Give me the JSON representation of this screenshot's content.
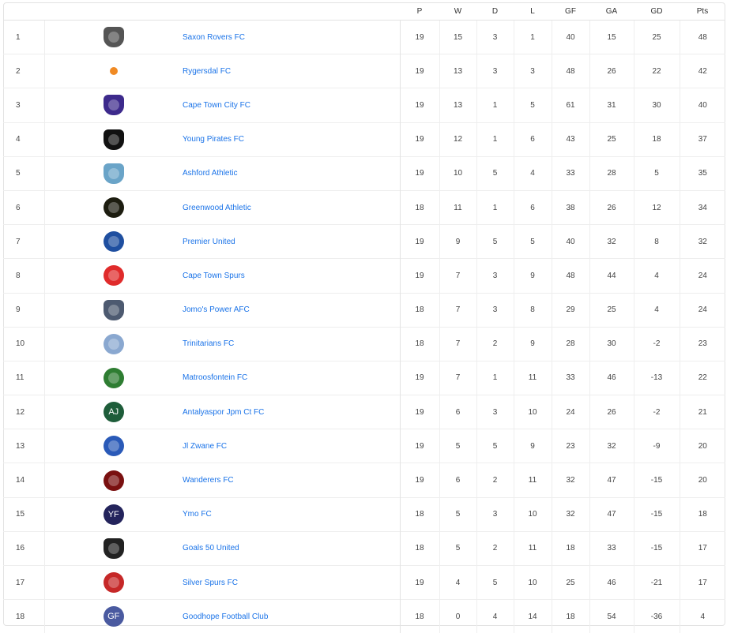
{
  "headers": [
    "P",
    "W",
    "D",
    "L",
    "GF",
    "GA",
    "GD",
    "Pts"
  ],
  "rows": [
    {
      "pos": "1",
      "team": "Saxon Rovers FC",
      "logo": "striped-shield-crest",
      "color": "#555555",
      "P": "19",
      "W": "15",
      "D": "3",
      "L": "1",
      "GF": "40",
      "GA": "15",
      "GD": "25",
      "Pts": "48"
    },
    {
      "pos": "2",
      "team": "Rygersdal FC",
      "logo": "small-orange-crest",
      "color": "#f08a24",
      "P": "19",
      "W": "13",
      "D": "3",
      "L": "3",
      "GF": "48",
      "GA": "26",
      "GD": "22",
      "Pts": "42"
    },
    {
      "pos": "3",
      "team": "Cape Town City FC",
      "logo": "purple-shield-crest",
      "color": "#3d2a8c",
      "P": "19",
      "W": "13",
      "D": "1",
      "L": "5",
      "GF": "61",
      "GA": "31",
      "GD": "30",
      "Pts": "40"
    },
    {
      "pos": "4",
      "team": "Young Pirates FC",
      "logo": "skull-crest",
      "color": "#111111",
      "P": "19",
      "W": "12",
      "D": "1",
      "L": "6",
      "GF": "43",
      "GA": "25",
      "GD": "18",
      "Pts": "37"
    },
    {
      "pos": "5",
      "team": "Ashford Athletic",
      "logo": "blue-square-crest",
      "color": "#6aa4c8",
      "P": "19",
      "W": "10",
      "D": "5",
      "L": "4",
      "GF": "33",
      "GA": "28",
      "GD": "5",
      "Pts": "35"
    },
    {
      "pos": "6",
      "team": "Greenwood Athletic",
      "logo": "black-gold-crest",
      "color": "#1d1d10",
      "P": "18",
      "W": "11",
      "D": "1",
      "L": "6",
      "GF": "38",
      "GA": "26",
      "GD": "12",
      "Pts": "34"
    },
    {
      "pos": "7",
      "team": "Premier United",
      "logo": "blue-ball-crest",
      "color": "#1f4fa0",
      "P": "19",
      "W": "9",
      "D": "5",
      "L": "5",
      "GF": "40",
      "GA": "32",
      "GD": "8",
      "Pts": "32"
    },
    {
      "pos": "8",
      "team": "Cape Town Spurs",
      "logo": "red-spur-crest",
      "color": "#e02b2b",
      "P": "19",
      "W": "7",
      "D": "3",
      "L": "9",
      "GF": "48",
      "GA": "44",
      "GD": "4",
      "Pts": "24"
    },
    {
      "pos": "9",
      "team": "Jomo's Power AFC",
      "logo": "grey-shield-crest",
      "color": "#4d5a70",
      "P": "18",
      "W": "7",
      "D": "3",
      "L": "8",
      "GF": "29",
      "GA": "25",
      "GD": "4",
      "Pts": "24"
    },
    {
      "pos": "10",
      "team": "Trinitarians FC",
      "logo": "light-blue-crest",
      "color": "#8aa8d0",
      "P": "18",
      "W": "7",
      "D": "2",
      "L": "9",
      "GF": "28",
      "GA": "30",
      "GD": "-2",
      "Pts": "23"
    },
    {
      "pos": "11",
      "team": "Matroosfontein FC",
      "logo": "green-red-crest",
      "color": "#2e7d32",
      "P": "19",
      "W": "7",
      "D": "1",
      "L": "11",
      "GF": "33",
      "GA": "46",
      "GD": "-13",
      "Pts": "22"
    },
    {
      "pos": "12",
      "team": "Antalyaspor Jpm Ct FC",
      "logo": "initials-crest",
      "initials": "AJ",
      "color": "#1e5d3a",
      "P": "19",
      "W": "6",
      "D": "3",
      "L": "10",
      "GF": "24",
      "GA": "26",
      "GD": "-2",
      "Pts": "21"
    },
    {
      "pos": "13",
      "team": "Jl Zwane FC",
      "logo": "blue-white-crest",
      "color": "#2a5ab8",
      "P": "19",
      "W": "5",
      "D": "5",
      "L": "9",
      "GF": "23",
      "GA": "32",
      "GD": "-9",
      "Pts": "20"
    },
    {
      "pos": "14",
      "team": "Wanderers FC",
      "logo": "dark-red-crest",
      "color": "#7a1010",
      "P": "19",
      "W": "6",
      "D": "2",
      "L": "11",
      "GF": "32",
      "GA": "47",
      "GD": "-15",
      "Pts": "20"
    },
    {
      "pos": "15",
      "team": "Ymo FC",
      "logo": "initials-crest",
      "initials": "YF",
      "color": "#24245c",
      "P": "18",
      "W": "5",
      "D": "3",
      "L": "10",
      "GF": "32",
      "GA": "47",
      "GD": "-15",
      "Pts": "18"
    },
    {
      "pos": "16",
      "team": "Goals 50 United",
      "logo": "black-gold-shield-crest",
      "color": "#222222",
      "P": "18",
      "W": "5",
      "D": "2",
      "L": "11",
      "GF": "18",
      "GA": "33",
      "GD": "-15",
      "Pts": "17"
    },
    {
      "pos": "17",
      "team": "Silver Spurs FC",
      "logo": "red-silver-crest",
      "color": "#c62828",
      "P": "19",
      "W": "4",
      "D": "5",
      "L": "10",
      "GF": "25",
      "GA": "46",
      "GD": "-21",
      "Pts": "17"
    },
    {
      "pos": "18",
      "team": "Goodhope Football Club",
      "logo": "initials-crest",
      "initials": "GF",
      "color": "#4a5aa0",
      "P": "18",
      "W": "0",
      "D": "4",
      "L": "14",
      "GF": "18",
      "GA": "54",
      "GD": "-36",
      "Pts": "4"
    }
  ]
}
